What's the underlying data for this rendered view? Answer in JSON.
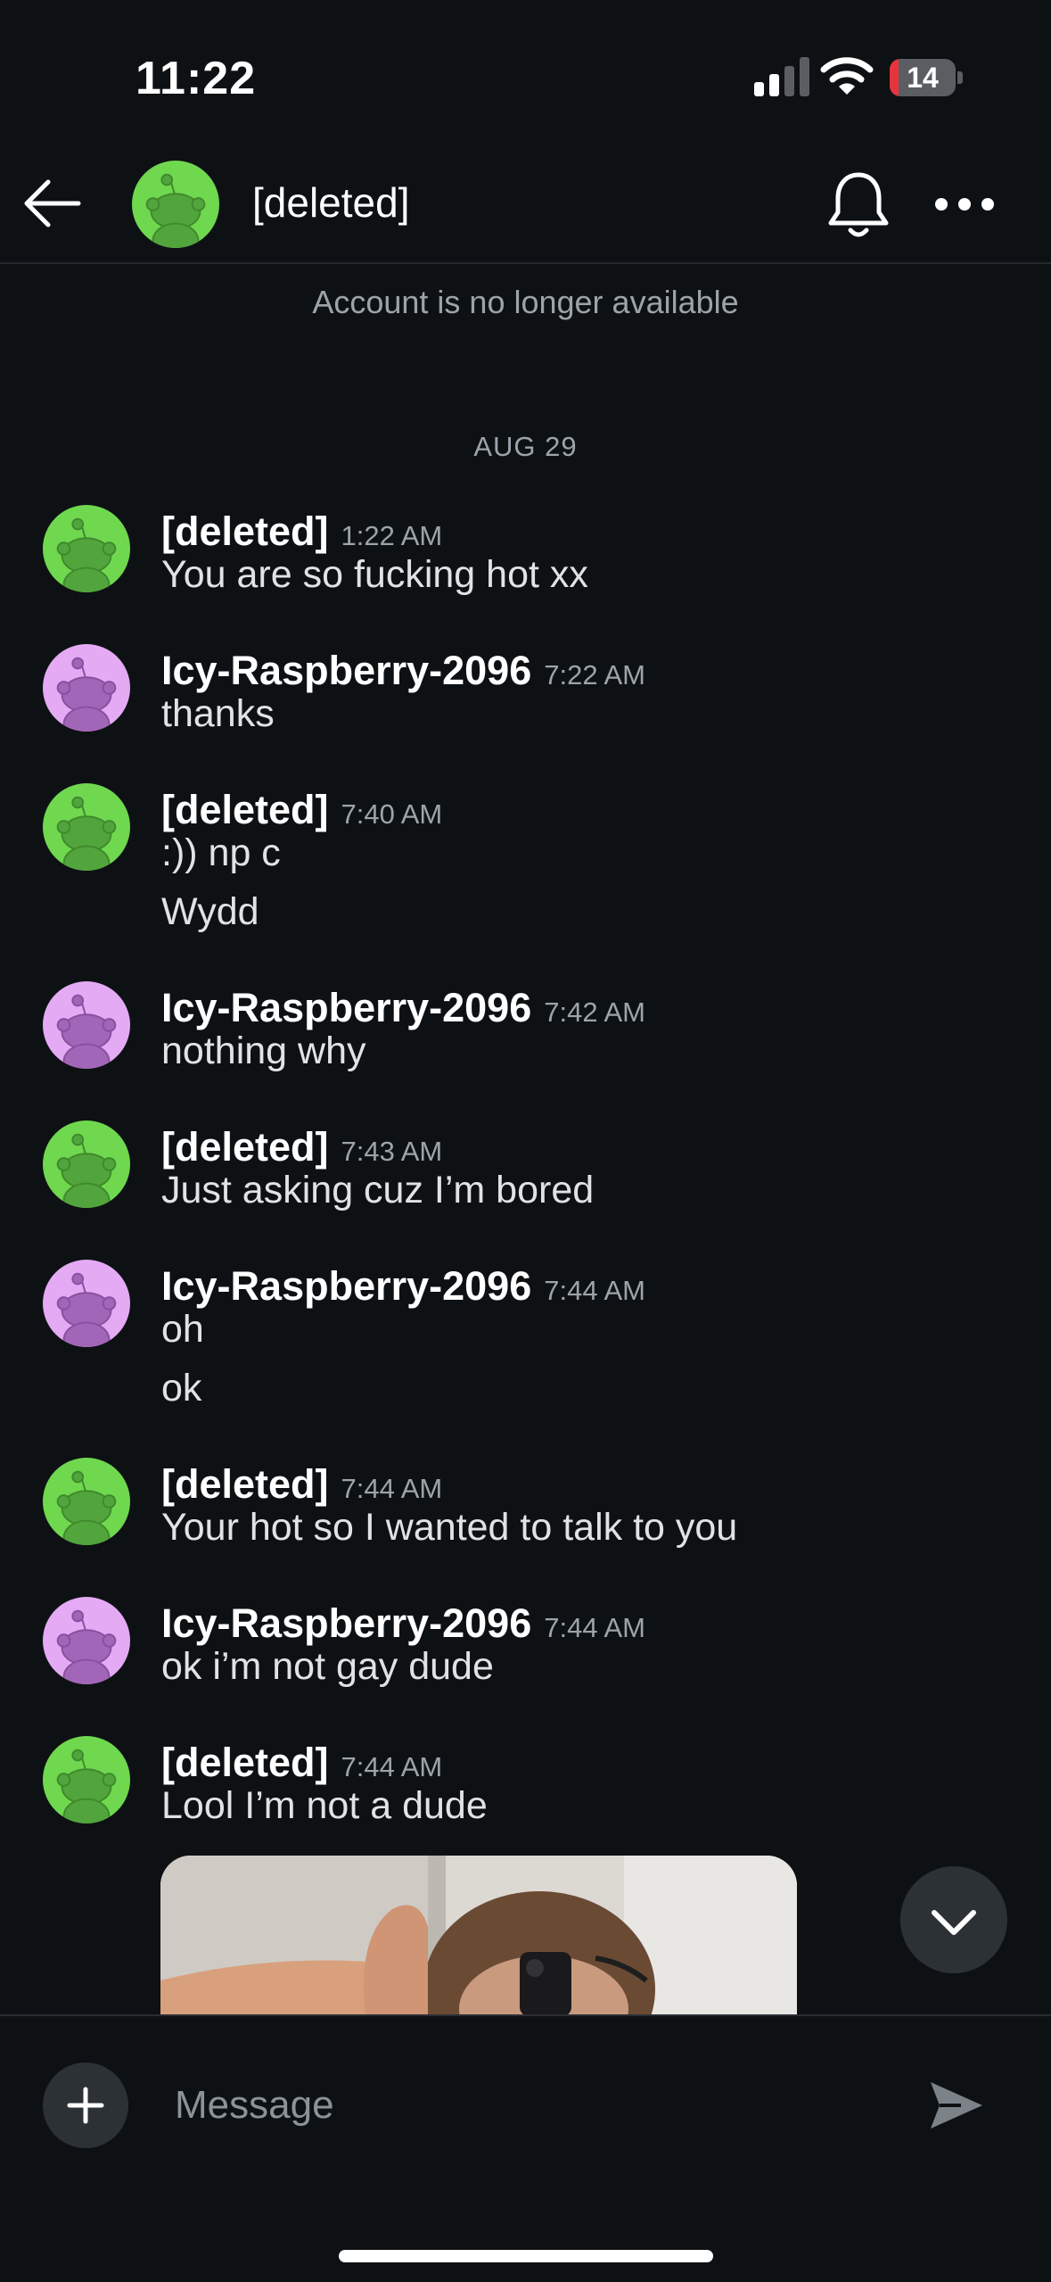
{
  "status_bar": {
    "time": "11:22",
    "battery": "14",
    "battery_fraction": 0.14
  },
  "header": {
    "title": "[deleted]",
    "icons": [
      "arrow-left-icon",
      "snoo-avatar-icon",
      "bell-icon",
      "more-horizontal-icon"
    ]
  },
  "notice": "Account is no longer available",
  "date_divider": "AUG 29",
  "colors": {
    "background": "#0e1114",
    "deleted_avatar": "#6fd84f",
    "user_avatar": "#e4aaf4",
    "muted_text": "#9ba4ab"
  },
  "messages": [
    {
      "user": "[deleted]",
      "time": "1:22 AM",
      "lines": [
        "You are so fucking hot xx"
      ]
    },
    {
      "user": "Icy-Raspberry-2096",
      "time": "7:22 AM",
      "lines": [
        "thanks"
      ]
    },
    {
      "user": "[deleted]",
      "time": "7:40 AM",
      "lines": [
        ":)) np c",
        "Wydd"
      ]
    },
    {
      "user": "Icy-Raspberry-2096",
      "time": "7:42 AM",
      "lines": [
        "nothing why"
      ]
    },
    {
      "user": "[deleted]",
      "time": "7:43 AM",
      "lines": [
        "Just asking cuz I’m bored"
      ]
    },
    {
      "user": "Icy-Raspberry-2096",
      "time": "7:44 AM",
      "lines": [
        "oh",
        "ok"
      ]
    },
    {
      "user": "[deleted]",
      "time": "7:44 AM",
      "lines": [
        "Your hot so I wanted to talk to you"
      ]
    },
    {
      "user": "Icy-Raspberry-2096",
      "time": "7:44 AM",
      "lines": [
        "ok i’m not gay dude"
      ]
    },
    {
      "user": "[deleted]",
      "time": "7:44 AM",
      "lines": [
        "Lool I’m not a dude"
      ]
    }
  ],
  "composer": {
    "placeholder": "Message",
    "icons": [
      "plus-icon",
      "send-icon"
    ]
  },
  "scroll_button_icon": "chevron-down-icon"
}
